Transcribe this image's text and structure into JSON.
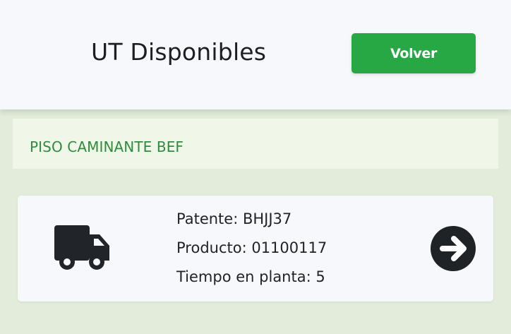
{
  "header": {
    "title": "UT Disponibles",
    "back_label": "Volver"
  },
  "section": {
    "title": "PISO CAMINANTE BEF"
  },
  "units": [
    {
      "patente": "Patente: BHJJ37",
      "producto": "Producto: 01100117",
      "tiempo": "Tiempo en planta: 5",
      "icon": "truck-icon",
      "action_icon": "arrow-right-circle-icon"
    }
  ],
  "colors": {
    "accent": "#28a745",
    "section_text": "#2f8c3f",
    "background": "#e3ecda",
    "banner": "#f0f7e8",
    "card": "#f7f8fb"
  }
}
